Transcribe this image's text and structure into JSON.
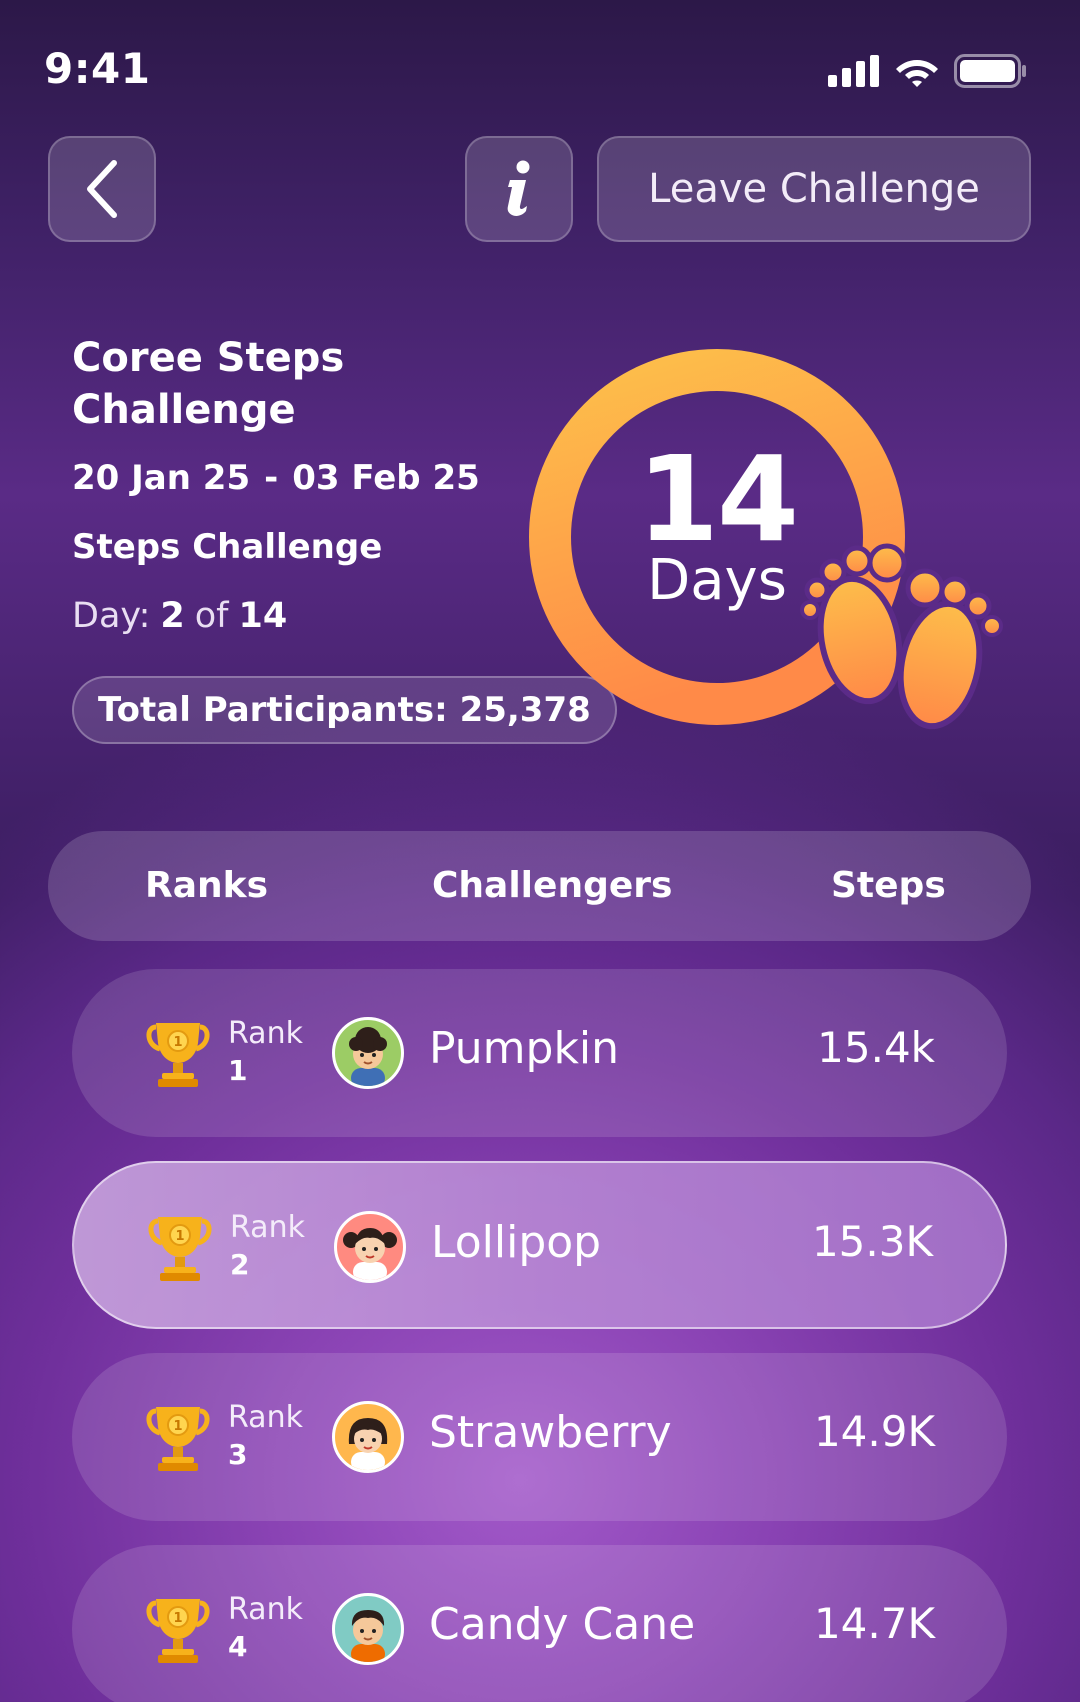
{
  "status_bar": {
    "time": "9:41"
  },
  "header": {
    "back_icon": "chevron-left-icon",
    "info_icon": "info-icon",
    "leave_label": "Leave Challenge"
  },
  "challenge": {
    "title": "Coree Steps Challenge",
    "start_date": "20 Jan 25",
    "date_separator": "-",
    "end_date": "03 Feb 25",
    "type": "Steps Challenge",
    "day_label": "Day:",
    "day_current": "2",
    "day_of": "of",
    "day_total": "14",
    "participants": "Total Participants: 25,378",
    "duration_number": "14",
    "duration_unit": "Days"
  },
  "table": {
    "col_ranks": "Ranks",
    "col_challengers": "Challengers",
    "col_steps": "Steps"
  },
  "rows": [
    {
      "rank_label": "Rank",
      "rank": "1",
      "name": "Pumpkin",
      "steps": "15.4k",
      "avatar_bg": "#9ccc65",
      "avatar": "boy-curly-avatar"
    },
    {
      "rank_label": "Rank",
      "rank": "2",
      "name": "Lollipop",
      "steps": "15.3K",
      "avatar_bg": "#ff8a80",
      "avatar": "girl-pigtails-avatar"
    },
    {
      "rank_label": "Rank",
      "rank": "3",
      "name": "Strawberry",
      "steps": "14.9K",
      "avatar_bg": "#ffb74d",
      "avatar": "girl-avatar"
    },
    {
      "rank_label": "Rank",
      "rank": "4",
      "name": "Candy Cane",
      "steps": "14.7K",
      "avatar_bg": "#80cbc4",
      "avatar": "boy-avatar"
    }
  ],
  "colors": {
    "accent_orange": "#ff8a3d",
    "accent_yellow": "#fdbd4a",
    "trophy_gold": "#f7b21b"
  }
}
